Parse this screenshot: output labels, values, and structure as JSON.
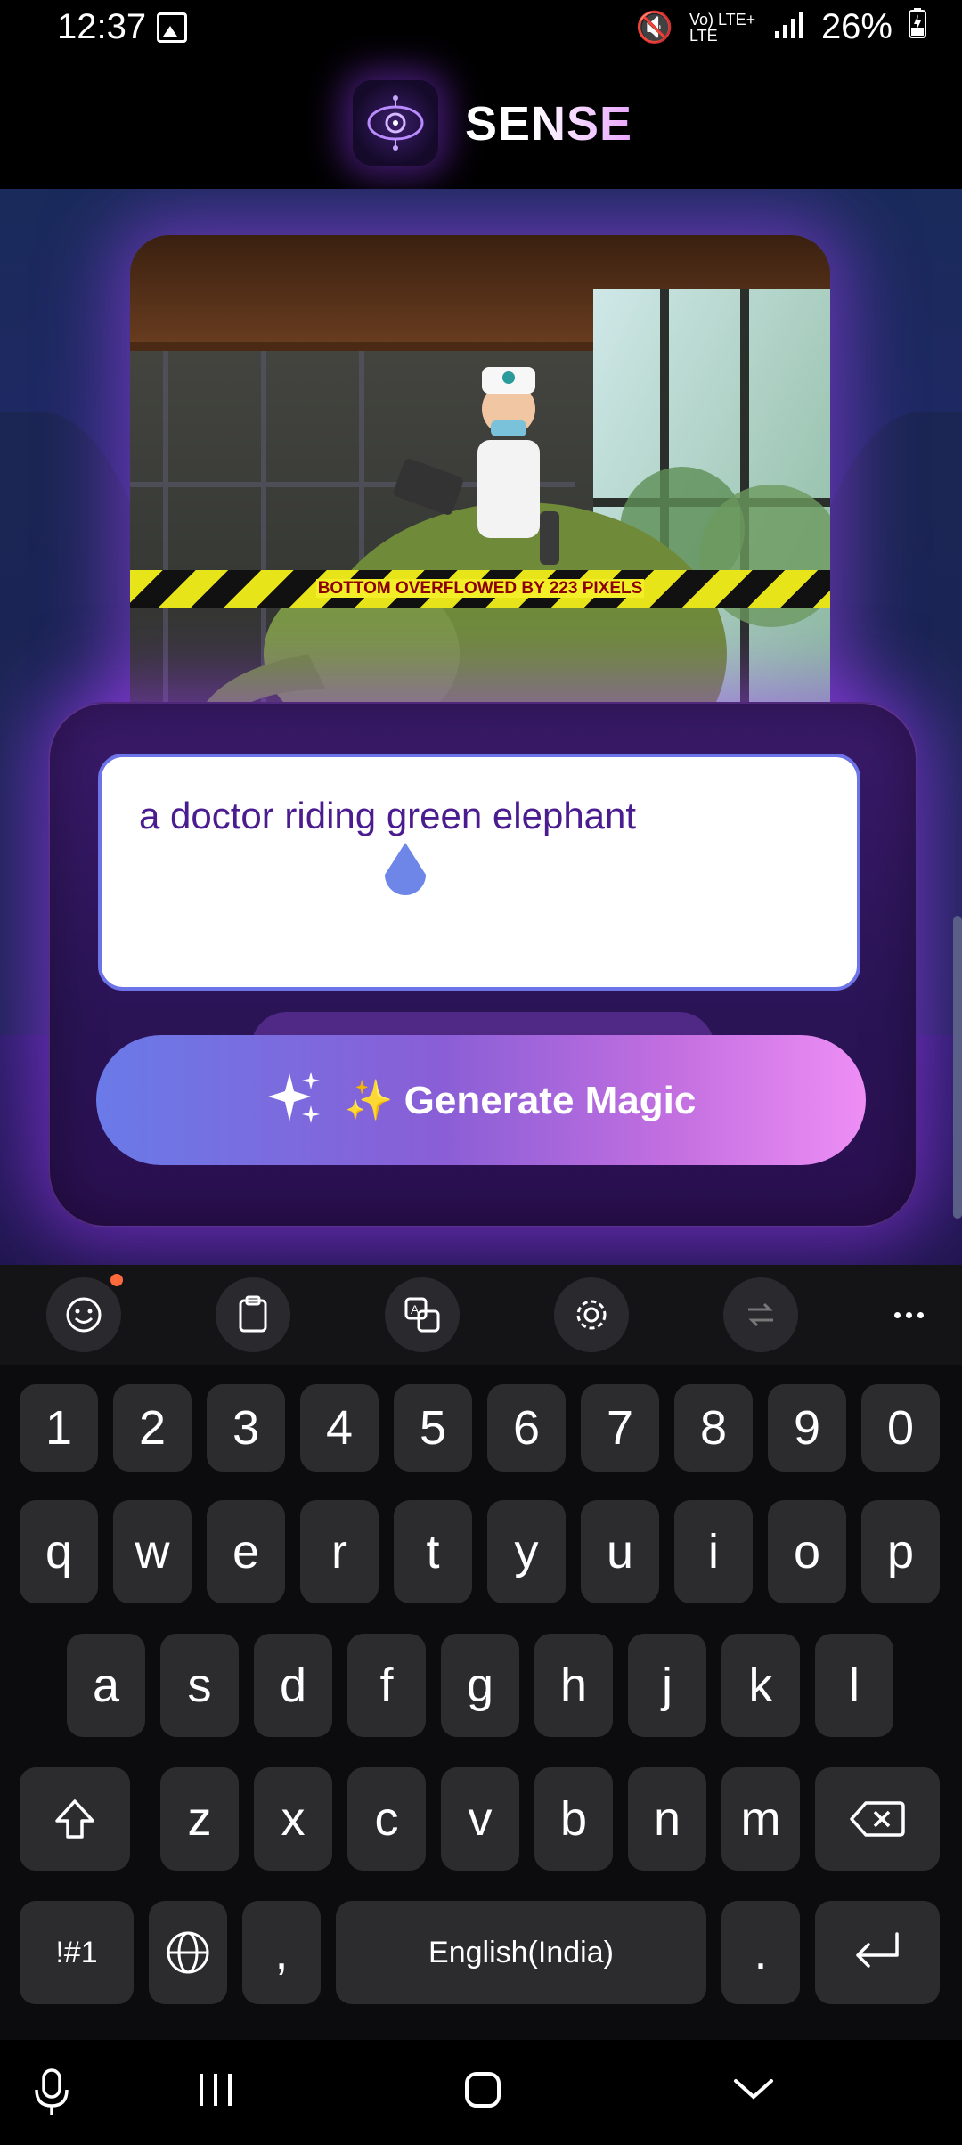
{
  "status_bar": {
    "time": "12:37",
    "network": "Vo) LTE+ LTE",
    "battery": "26%"
  },
  "header": {
    "brand": "SENSE"
  },
  "image_preview": {
    "overflow_warning": "BOTTOM OVERFLOWED BY 223 PIXELS"
  },
  "prompt_input": {
    "value": "a doctor riding green elephant"
  },
  "generate_button": {
    "label": "✨ Generate Magic"
  },
  "keyboard": {
    "row_numbers": [
      "1",
      "2",
      "3",
      "4",
      "5",
      "6",
      "7",
      "8",
      "9",
      "0"
    ],
    "row_1": [
      "q",
      "w",
      "e",
      "r",
      "t",
      "y",
      "u",
      "i",
      "o",
      "p"
    ],
    "row_2": [
      "a",
      "s",
      "d",
      "f",
      "g",
      "h",
      "j",
      "k",
      "l"
    ],
    "row_3": [
      "z",
      "x",
      "c",
      "v",
      "b",
      "n",
      "m"
    ],
    "symbols_key": "!#1",
    "comma_key": ",",
    "space_label": "English(India)",
    "period_key": "."
  },
  "colors": {
    "accent": "#6d74e8",
    "button_gradient_start": "#6a7ae8",
    "button_gradient_end": "#ee8ef5",
    "prompt_text": "#4a1c8f"
  }
}
